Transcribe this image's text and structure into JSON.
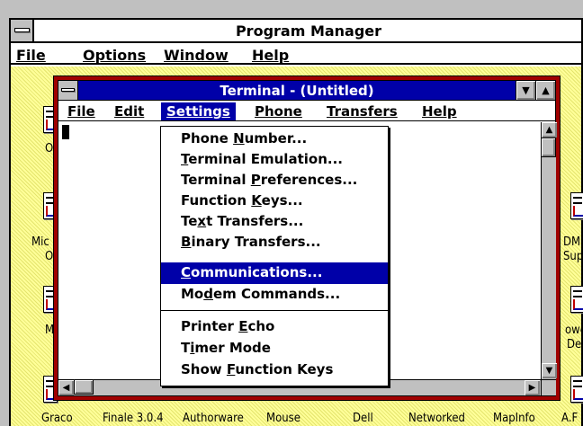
{
  "program_manager": {
    "title": "Program Manager",
    "menu": [
      "File",
      "Options",
      "Window",
      "Help"
    ],
    "groups": [
      {
        "label": "O"
      },
      {
        "label": "Mic"
      },
      {
        "label": "O"
      },
      {
        "label": "M"
      },
      {
        "label": "DMI"
      },
      {
        "label": "Sup"
      },
      {
        "label": "owe"
      },
      {
        "label": "De"
      },
      {
        "label": "Graco"
      },
      {
        "label": "Finale 3.0.4"
      },
      {
        "label": "Authorware"
      },
      {
        "label": "Mouse"
      },
      {
        "label": "Dell"
      },
      {
        "label": "Networked"
      },
      {
        "label": "MapInfo"
      },
      {
        "label": "A.F"
      }
    ]
  },
  "terminal": {
    "title": "Terminal - (Untitled)",
    "menu": [
      "File",
      "Edit",
      "Settings",
      "Phone",
      "Transfers",
      "Help"
    ],
    "active_menu": "Settings"
  },
  "settings_menu": {
    "items": [
      {
        "label": "Phone Number...",
        "u": 6
      },
      {
        "label": "Terminal Emulation...",
        "u": 0
      },
      {
        "label": "Terminal Preferences...",
        "u": 9
      },
      {
        "label": "Function Keys...",
        "u": 9
      },
      {
        "label": "Text Transfers...",
        "u": 2
      },
      {
        "label": "Binary Transfers...",
        "u": 0
      },
      {
        "label": "Communications...",
        "u": 0,
        "selected": true
      },
      {
        "label": "Modem Commands...",
        "u": 2
      },
      {
        "label": "Printer Echo",
        "u": 8
      },
      {
        "label": "Timer Mode",
        "u": 1
      },
      {
        "label": "Show Function Keys",
        "u": 5
      }
    ]
  },
  "colors": {
    "titlebar_active": "#0000a8",
    "window_frame": "#a00000",
    "desktop_pattern": "#ffff99"
  }
}
